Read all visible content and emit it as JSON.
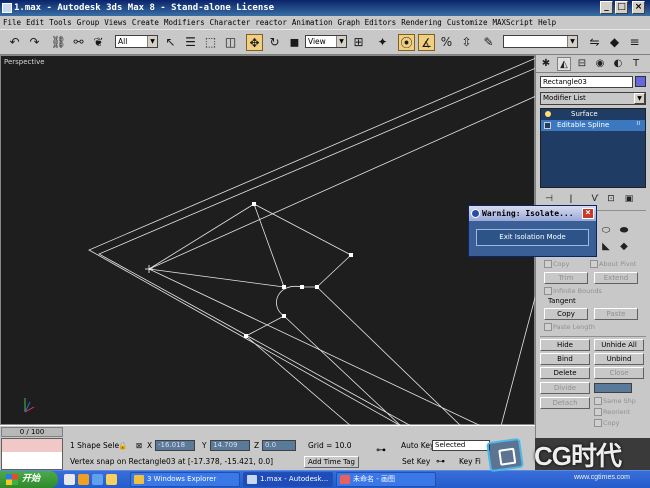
{
  "window": {
    "title": "1.max - Autodesk 3ds Max 8 - Stand-alone License",
    "minimize": "_",
    "maximize": "□",
    "close": "×"
  },
  "menu": [
    "File",
    "Edit",
    "Tools",
    "Group",
    "Views",
    "Create",
    "Modifiers",
    "Character",
    "reactor",
    "Animation",
    "Graph Editors",
    "Rendering",
    "Customize",
    "MAXScript",
    "Help"
  ],
  "toolbar": {
    "selection_filter": "All",
    "ref_coord": "View"
  },
  "viewport": {
    "label": "Perspective"
  },
  "command_panel": {
    "object_name": "Rectangle03",
    "object_color": "#6666dd",
    "modifier_list": "Modifier List",
    "stack": [
      {
        "label": "Surface"
      },
      {
        "label": "Editable Spline"
      }
    ],
    "buttons": {
      "copy": "Copy",
      "about_pivot": "About Pivot",
      "trim": "Trim",
      "extend": "Extend",
      "infinite_bounds": "Infinite Bounds",
      "tangent": "Tangent",
      "tcopy": "Copy",
      "paste": "Paste",
      "paste_length": "Paste Length",
      "hide": "Hide",
      "unhide_all": "Unhide All",
      "bind": "Bind",
      "unbind": "Unbind",
      "delete": "Delete",
      "close": "Close",
      "divide": "Divide",
      "detach": "Detach",
      "same_shp": "Same Shp",
      "reorient": "Reorient",
      "copy2": "Copy"
    }
  },
  "warning": {
    "title": "Warning: Isolate...",
    "close": "×",
    "button": "Exit Isolation Mode"
  },
  "status": {
    "time": "0 / 100",
    "selection": "1 Shape Sele",
    "x_label": "X",
    "x": "-16.018",
    "y_label": "Y",
    "y": "14.709",
    "z_label": "Z",
    "z": "0.0",
    "grid": "Grid = 10.0",
    "add_time_tag": "Add Time Tag",
    "prompt": "Vertex snap on Rectangle03 at [-17.378, -15.421, 0.0]",
    "auto_key": "Auto Key",
    "set_key": "Set Key",
    "key_selected": "Selected",
    "key_filters": "Key Fi"
  },
  "taskbar": {
    "start": "开始",
    "tasks": [
      "3 Windows Explorer",
      "1.max - Autodesk...",
      "未命名 - 画图"
    ]
  },
  "watermark": {
    "brand": "CG时代",
    "url": "www.cgtimes.com"
  }
}
